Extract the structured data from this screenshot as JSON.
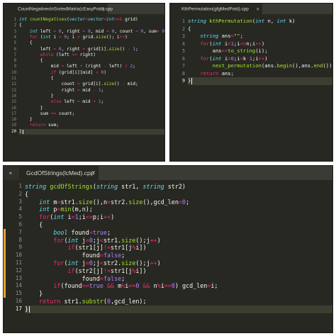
{
  "panes": [
    {
      "tab": "CountNegativesInSortedMatrix(cEasyPotd).cpp",
      "nav_left": "◀",
      "close": "×",
      "current_line": 20,
      "lines": [
        "int countNegatives(vector<vector<int>>& grid)",
        "{",
        "    int left = 0, right = 0, mid = 0, count = 0, sum= 0;",
        "    for (int i = 0; i < grid.size(); i++)",
        "    {",
        "        left = 0, right = grid[i].size() - 1;",
        "        while (left <= right)",
        "        {",
        "            mid = left + (right - left) / 2;",
        "            if (grid[i][mid] < 0)",
        "            {",
        "                count = grid[i].size() - mid;",
        "                right = mid - 1;",
        "            }",
        "            else left = mid + 1;",
        "        }",
        "        sum += count;",
        "    }",
        "    return sum;",
        "}"
      ]
    },
    {
      "tab": "KthPermutation(gfgMedPotd).cpp",
      "close": "×",
      "current_line": 9,
      "lines": [
        "string kthPermutation(int n, int k)",
        "{",
        "    string ans=\"\";",
        "    for(int i=1;i<=n;i++)",
        "        ans+=to_string(i);",
        "    for(int i=0;i<k-1;i++)",
        "        next_permutation(ans.begin(),ans.end());",
        "    return ans;",
        "}"
      ]
    },
    {
      "tab": "GcdOfStrings(lcMed).cpp",
      "nav_left": "◀",
      "close": "×",
      "current_line": 17,
      "lines": [
        "string gcdOfStrings(string str1, string str2)",
        "{",
        "    int m=str1.size(),n=str2.size(),gcd_len=0;",
        "    int p=min(m,n);",
        "    for(int i=1;i<=p;i++)",
        "    {",
        "        bool found=true;",
        "        for(int j=0;j<str1.size();j++)",
        "            if(str1[j]!=str1[j%i])",
        "                found=false;",
        "        for(int j=0;j<str2.size();j++)",
        "            if(str2[j]!=str1[j%i])",
        "                found=false;",
        "        if(found==true && m%i==0 && n%i==0) gcd_len=i;",
        "    }",
        "    return str1.substr(0,gcd_len);",
        "}"
      ]
    }
  ]
}
